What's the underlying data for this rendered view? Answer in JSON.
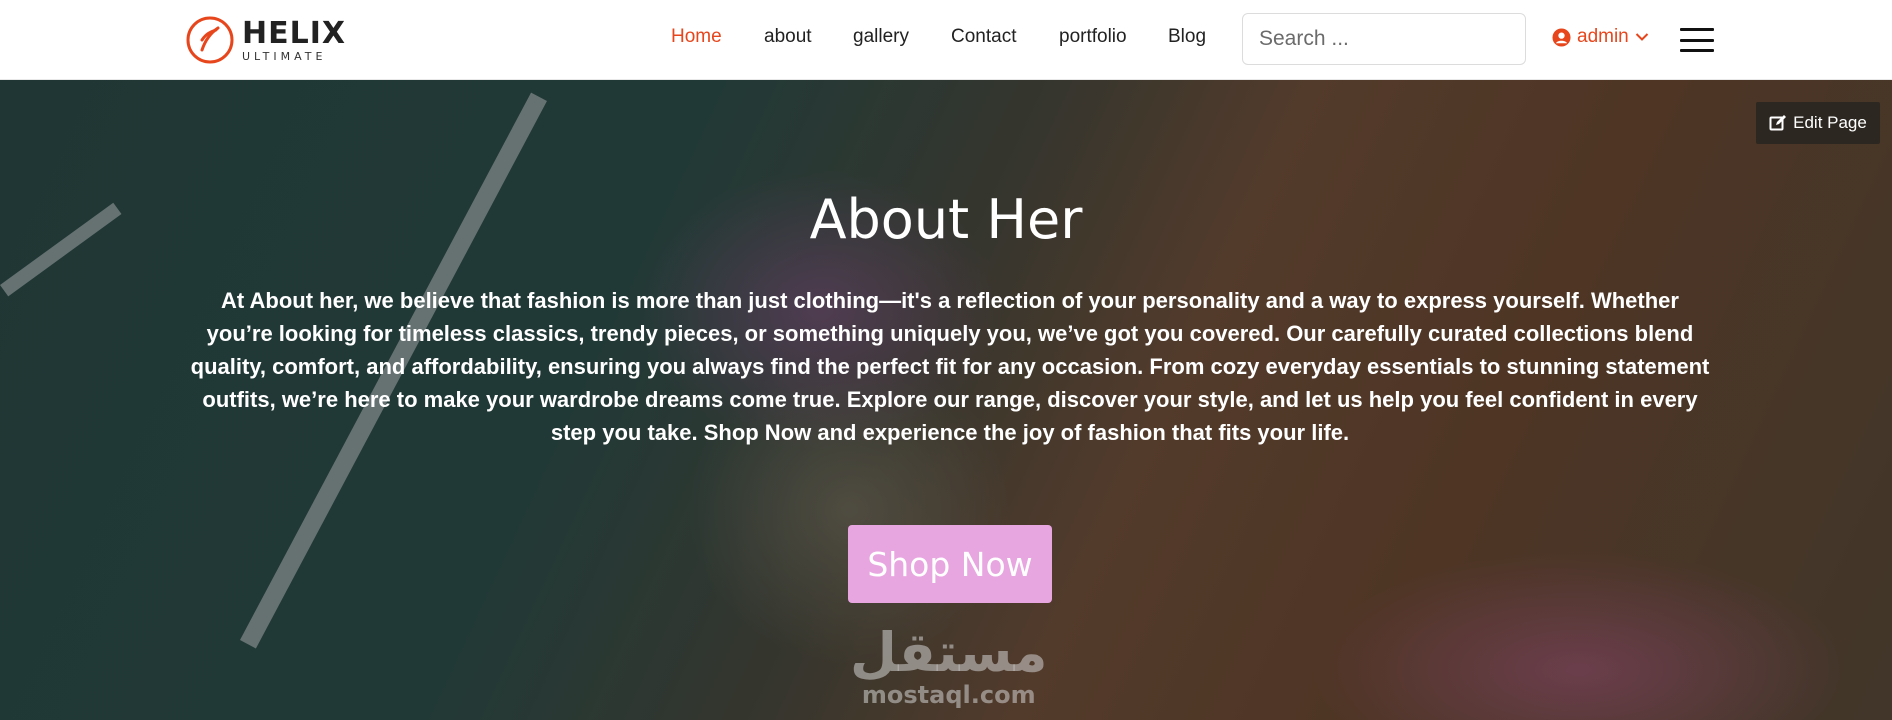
{
  "brand": {
    "logo_main": "HELIX",
    "logo_sub": "ULTIMATE",
    "accent_color": "#e7461c"
  },
  "nav": {
    "items": [
      {
        "label": "Home",
        "active": true
      },
      {
        "label": "about"
      },
      {
        "label": "gallery"
      },
      {
        "label": "Contact"
      },
      {
        "label": "portfolio"
      },
      {
        "label": "Blog"
      }
    ]
  },
  "search": {
    "placeholder": "Search ..."
  },
  "user": {
    "name": "admin",
    "icon": "user-circle-icon"
  },
  "menu": {
    "icon": "hamburger-icon"
  },
  "hero": {
    "edit_label": "Edit Page",
    "title": "About Her",
    "text": "At About her, we believe that fashion is more than just clothing—it's a reflection of your personality and a way to express yourself. Whether you’re looking for timeless classics, trendy pieces, or something uniquely you, we’ve got you covered. Our carefully curated collections blend quality, comfort, and affordability, ensuring you always find the perfect fit for any occasion. From cozy everyday essentials to stunning statement outfits, we’re here to make your wardrobe dreams come true. Explore our range, discover your style, and let us help you feel confident in every step you take. Shop Now and experience the joy of fashion that fits your life.",
    "cta_label": "Shop Now",
    "cta_color": "#e8a6e0"
  },
  "watermark": {
    "arabic": "مستقل",
    "latin": "mostaql.com"
  }
}
